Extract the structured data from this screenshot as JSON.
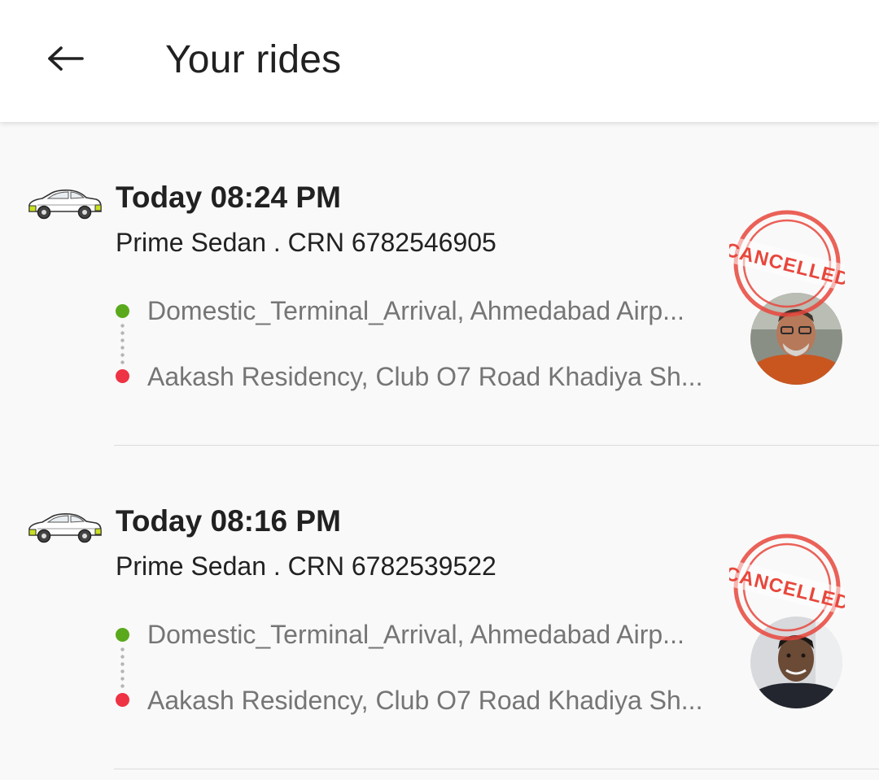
{
  "header": {
    "back_icon": "arrow-left-icon",
    "title": "Your rides"
  },
  "rides": [
    {
      "time": "Today 08:24 PM",
      "meta": "Prime Sedan . CRN 6782546905",
      "pickup": "Domestic_Terminal_Arrival, Ahmedabad Airp...",
      "drop": "Aakash Residency, Club O7 Road Khadiya Sh...",
      "status": "CANCELLED",
      "vehicle_icon": "sedan-car-icon",
      "driver_avatar": "driver-avatar"
    },
    {
      "time": "Today 08:16 PM",
      "meta": "Prime Sedan . CRN 6782539522",
      "pickup": "Domestic_Terminal_Arrival, Ahmedabad Airp...",
      "drop": "Aakash Residency, Club O7 Road Khadiya Sh...",
      "status": "CANCELLED",
      "vehicle_icon": "sedan-car-icon",
      "driver_avatar": "driver-avatar"
    }
  ],
  "colors": {
    "pickup_dot": "#5aa91c",
    "drop_dot": "#ee3344",
    "stamp": "#e8473c",
    "car_accent": "#c8e021"
  }
}
